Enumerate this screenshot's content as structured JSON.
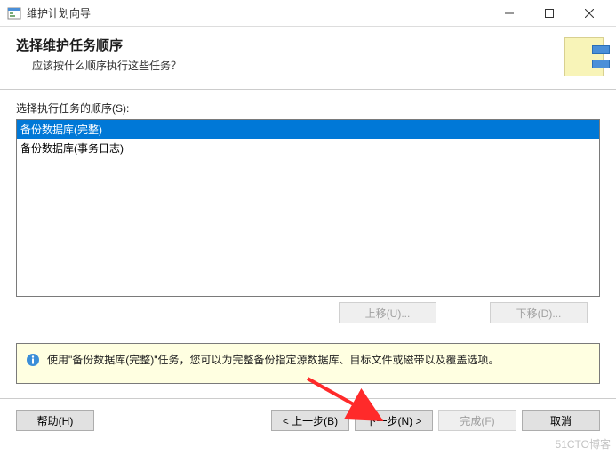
{
  "window": {
    "title": "维护计划向导"
  },
  "header": {
    "heading": "选择维护任务顺序",
    "subtitle": "应该按什么顺序执行这些任务？"
  },
  "list": {
    "label": "选择执行任务的顺序(S):",
    "items": [
      "备份数据库(完整)",
      "备份数据库(事务日志)"
    ]
  },
  "buttons": {
    "move_up": "上移(U)...",
    "move_down": "下移(D)...",
    "help": "帮助(H)",
    "back": "< 上一步(B)",
    "next": "下一步(N) >",
    "finish": "完成(F)",
    "cancel": "取消"
  },
  "info": {
    "text": "使用\"备份数据库(完整)\"任务，您可以为完整备份指定源数据库、目标文件或磁带以及覆盖选项。"
  },
  "watermark": "51CTO博客"
}
